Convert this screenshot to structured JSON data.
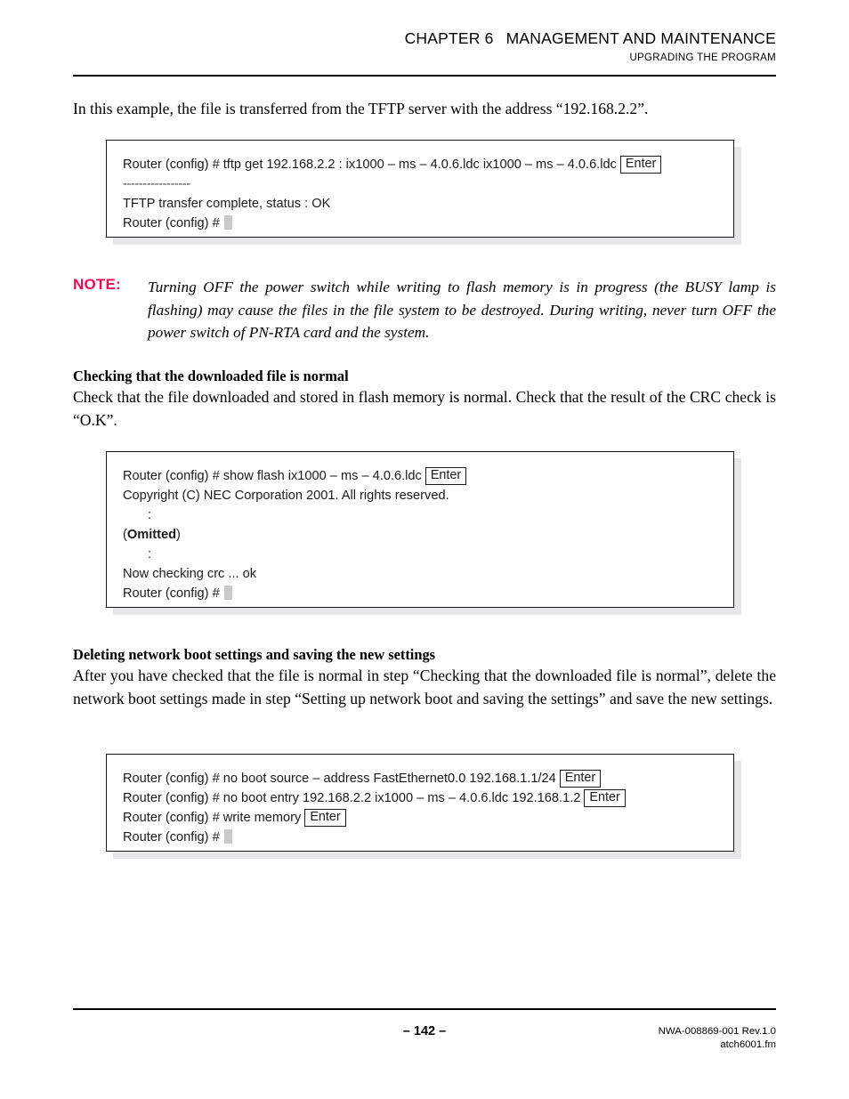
{
  "header": {
    "chapter": "CHAPTER 6",
    "title": "MANAGEMENT AND MAINTENANCE",
    "subtitle": "UPGRADING THE PROGRAM"
  },
  "intro": {
    "paragraph": "In this example, the file is transferred from the TFTP server with the address “192.168.2.2”."
  },
  "console_tftp": {
    "line1_pre": "Router (config) # tftp get 192.168.2.2 : ix1000 – ms – 4.0.6.ldc ix1000 – ms – 4.0.6.ldc",
    "line1_key": "Enter",
    "line2": "-----------------",
    "line3": "TFTP transfer complete, status : OK",
    "line4_pre": "Router (config) #"
  },
  "note": {
    "label": "NOTE:",
    "text": "Turning OFF the power switch while writing to flash memory is in progress (the BUSY lamp is flashing) may cause the files in the file system to be destroyed. During writing, never turn OFF the power switch of PN-RTA card and the system.",
    "label_color": "#EC0A50"
  },
  "section_checking": {
    "heading": "Checking that the downloaded file is normal",
    "paragraph": "Check that the file downloaded and stored in flash memory is normal. Check that the result of the CRC check is “O.K”."
  },
  "console_flash": {
    "line1_pre": "Router (config) # show flash ix1000 – ms – 4.0.6.ldc",
    "line1_key": "Enter",
    "line2": "Copyright (C) NEC Corporation 2001. All rights reserved.",
    "line3": ":",
    "line4_open": "(",
    "line4_bold": "Omitted",
    "line4_close": ")",
    "line5": ":",
    "line6": "Now checking crc ... ok",
    "line7_pre": "Router (config) #"
  },
  "section_deleting": {
    "heading": "Deleting network boot settings and saving the new settings",
    "paragraph": "After you have checked that the file is normal in step “Checking that the downloaded file is normal”, delete the network boot settings made in step “Setting up network boot and saving the settings” and save the new settings."
  },
  "console_boot": {
    "line1_pre": "Router (config) # no boot source – address FastEthernet0.0 192.168.1.1/24",
    "line1_key": "Enter",
    "line2_pre": "Router (config) # no boot entry 192.168.2.2 ix1000 – ms – 4.0.6.ldc 192.168.1.2",
    "line2_key": "Enter",
    "line3_pre": "Router (config) # write memory",
    "line3_key": "Enter",
    "line4_pre": "Router (config) #"
  },
  "footer": {
    "page_number": "– 142 –",
    "doc_id": "NWA-008869-001 Rev.1.0",
    "file_name": "atch6001.fm"
  }
}
